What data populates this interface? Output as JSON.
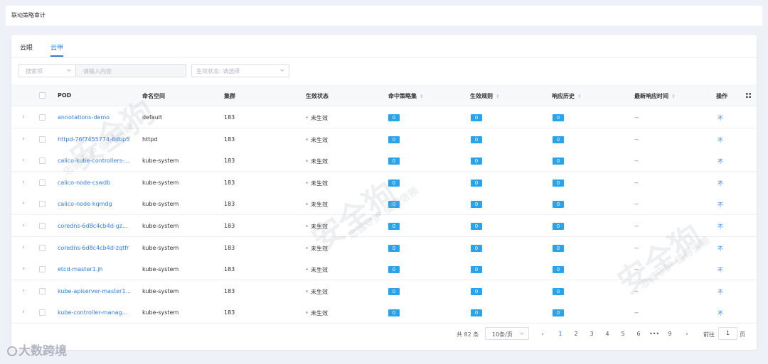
{
  "page_title": "联动策略审计",
  "tabs": [
    {
      "label": "云眼",
      "active": false
    },
    {
      "label": "云甲",
      "active": true
    }
  ],
  "filters": {
    "search_field_placeholder": "搜索项",
    "search_input_placeholder": "请输入内容",
    "status_select_placeholder": "生效状态: 请选择"
  },
  "columns": {
    "pod": "POD",
    "namespace": "命名空间",
    "cluster": "集群",
    "status": "生效状态",
    "hit_policy": "命中策略集",
    "rules": "生效规则",
    "history": "响应历史",
    "latest_time": "最新响应时间",
    "action": "操作"
  },
  "rows": [
    {
      "pod": "annotations-demo",
      "namespace": "default",
      "cluster": "183",
      "status": "未生效",
      "hit": "0",
      "rules": "0",
      "history": "0",
      "latest": "--",
      "action": "不"
    },
    {
      "pod": "httpd-76f7455774-6dbp5",
      "namespace": "httpd",
      "cluster": "183",
      "status": "未生效",
      "hit": "0",
      "rules": "0",
      "history": "0",
      "latest": "--",
      "action": "不"
    },
    {
      "pod": "calico-kube-controllers-...",
      "namespace": "kube-system",
      "cluster": "183",
      "status": "未生效",
      "hit": "0",
      "rules": "0",
      "history": "0",
      "latest": "--",
      "action": "不"
    },
    {
      "pod": "calico-node-cswdb",
      "namespace": "kube-system",
      "cluster": "183",
      "status": "未生效",
      "hit": "0",
      "rules": "0",
      "history": "0",
      "latest": "--",
      "action": "不"
    },
    {
      "pod": "calico-node-kqmdg",
      "namespace": "kube-system",
      "cluster": "183",
      "status": "未生效",
      "hit": "0",
      "rules": "0",
      "history": "0",
      "latest": "--",
      "action": "不"
    },
    {
      "pod": "coredns-6d8c4cb4d-gz...",
      "namespace": "kube-system",
      "cluster": "183",
      "status": "未生效",
      "hit": "0",
      "rules": "0",
      "history": "0",
      "latest": "--",
      "action": "不"
    },
    {
      "pod": "coredns-6d8c4cb4d-zqtfr",
      "namespace": "kube-system",
      "cluster": "183",
      "status": "未生效",
      "hit": "0",
      "rules": "0",
      "history": "0",
      "latest": "--",
      "action": "不"
    },
    {
      "pod": "etcd-master1.jh",
      "namespace": "kube-system",
      "cluster": "183",
      "status": "未生效",
      "hit": "0",
      "rules": "0",
      "history": "0",
      "latest": "--",
      "action": "不"
    },
    {
      "pod": "kube-apiserver-master1...",
      "namespace": "kube-system",
      "cluster": "183",
      "status": "未生效",
      "hit": "0",
      "rules": "0",
      "history": "0",
      "latest": "--",
      "action": "不"
    },
    {
      "pod": "kube-controller-manag...",
      "namespace": "kube-system",
      "cluster": "183",
      "status": "未生效",
      "hit": "0",
      "rules": "0",
      "history": "0",
      "latest": "--",
      "action": "不"
    }
  ],
  "pagination": {
    "total": "共 82 条",
    "page_size": "10条/页",
    "prev": "‹",
    "pages": [
      "1",
      "2",
      "3",
      "4",
      "5",
      "6",
      "•••",
      "9"
    ],
    "active_page": "1",
    "next": "›",
    "goto_label": "前往",
    "goto_value": "1",
    "page_suffix": "页"
  },
  "watermark": {
    "brand": "安全狗",
    "slogan": "忠诚守护 值得信赖"
  },
  "footer_logo": "大数跨境",
  "colors": {
    "accent": "#2f7de1",
    "badge": "#29a3ea",
    "background": "#eef1f8"
  }
}
